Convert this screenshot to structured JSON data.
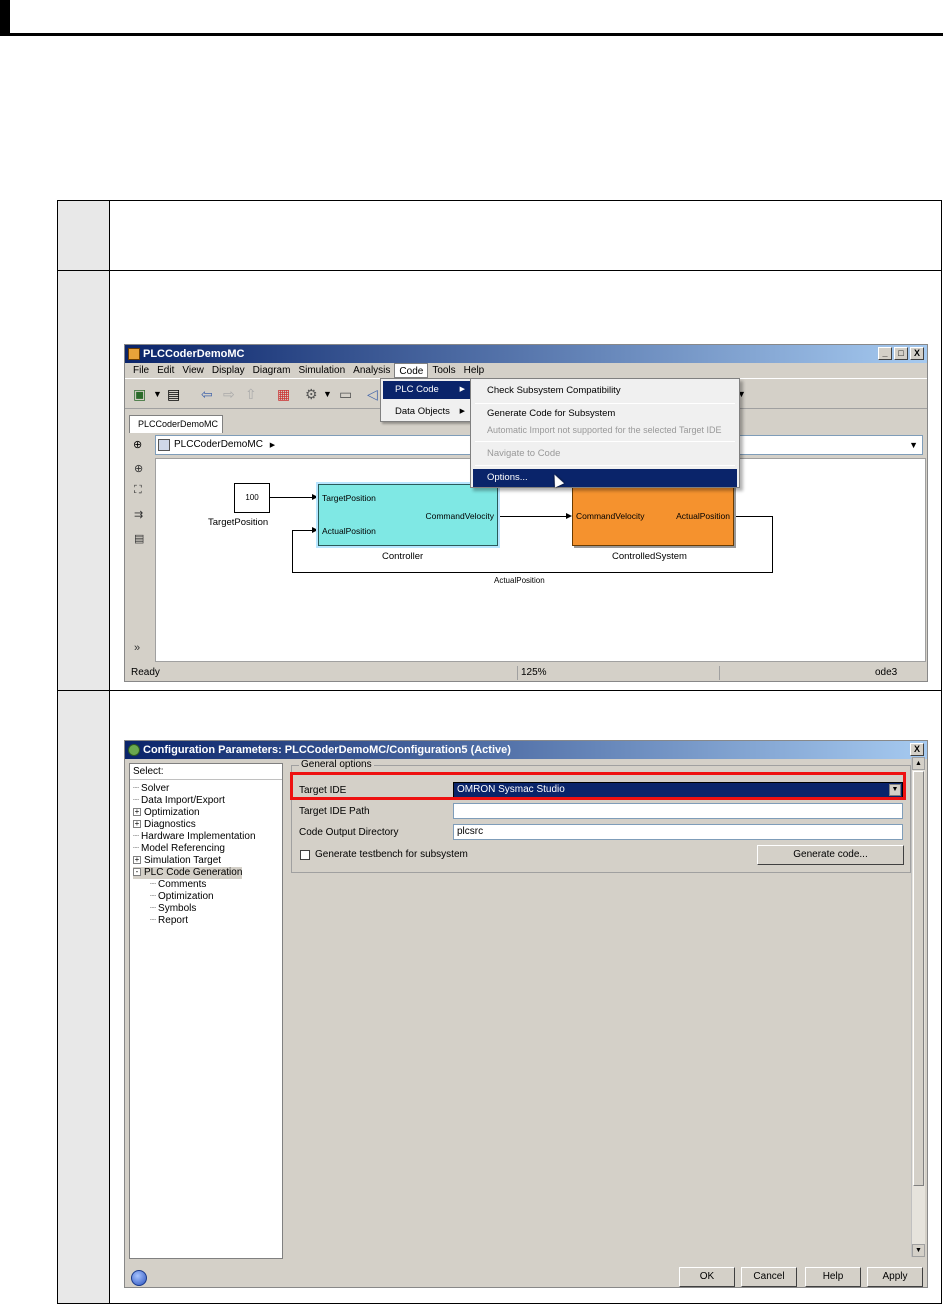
{
  "simulink": {
    "title": "PLCCoderDemoMC",
    "win_minimize": "_",
    "win_restore": "□",
    "win_close": "X",
    "menu": [
      "File",
      "Edit",
      "View",
      "Display",
      "Diagram",
      "Simulation",
      "Analysis",
      "Code",
      "Tools",
      "Help"
    ],
    "active_menu": "Code",
    "tab": "PLCCoderDemoMC",
    "address": "PLCCoderDemoMC",
    "code_menu": {
      "items": [
        {
          "label": "PLC Code",
          "highlighted": true
        },
        {
          "label": "Data Objects",
          "highlighted": false
        }
      ]
    },
    "plc_submenu": {
      "items": [
        {
          "label": "Check Subsystem Compatibility",
          "disabled": false
        },
        {
          "label": "Generate Code for Subsystem",
          "disabled": false
        },
        {
          "label": "Automatic Import not supported for the selected Target IDE",
          "disabled": true
        },
        {
          "label": "Navigate to Code",
          "disabled": true
        },
        {
          "label": "Options...",
          "highlighted": true
        }
      ]
    },
    "model": {
      "const_value": "100",
      "const_name": "TargetPosition",
      "controller": {
        "name": "Controller",
        "in1": "TargetPosition",
        "in2": "ActualPosition",
        "out1": "CommandVelocity"
      },
      "system": {
        "name": "ControlledSystem",
        "in1": "CommandVelocity",
        "out1": "ActualPosition"
      },
      "feedback_label": "ActualPosition"
    },
    "status": {
      "left": "Ready",
      "zoom": "125%",
      "solver": "ode3"
    }
  },
  "config": {
    "title": "Configuration Parameters: PLCCoderDemoMC/Configuration5 (Active)",
    "close": "X",
    "tree_header": "Select:",
    "tree": [
      {
        "label": "Solver",
        "indent": 0,
        "expander": ""
      },
      {
        "label": "Data Import/Export",
        "indent": 0,
        "expander": ""
      },
      {
        "label": "Optimization",
        "indent": 0,
        "expander": "+"
      },
      {
        "label": "Diagnostics",
        "indent": 0,
        "expander": "+"
      },
      {
        "label": "Hardware Implementation",
        "indent": 0,
        "expander": ""
      },
      {
        "label": "Model Referencing",
        "indent": 0,
        "expander": ""
      },
      {
        "label": "Simulation Target",
        "indent": 0,
        "expander": "+"
      },
      {
        "label": "PLC Code Generation",
        "indent": 0,
        "expander": "-",
        "selected": true
      },
      {
        "label": "Comments",
        "indent": 1,
        "expander": ""
      },
      {
        "label": "Optimization",
        "indent": 1,
        "expander": ""
      },
      {
        "label": "Symbols",
        "indent": 1,
        "expander": ""
      },
      {
        "label": "Report",
        "indent": 1,
        "expander": ""
      }
    ],
    "group_title": "General options",
    "target_ide_label": "Target IDE",
    "target_ide_value": "OMRON Sysmac Studio",
    "target_ide_path_label": "Target IDE Path",
    "target_ide_path_value": "",
    "code_output_label": "Code Output Directory",
    "code_output_value": "plcsrc",
    "testbench_label": "Generate testbench for subsystem",
    "generate_button": "Generate code...",
    "ok": "OK",
    "cancel": "Cancel",
    "help": "Help",
    "apply": "Apply"
  }
}
